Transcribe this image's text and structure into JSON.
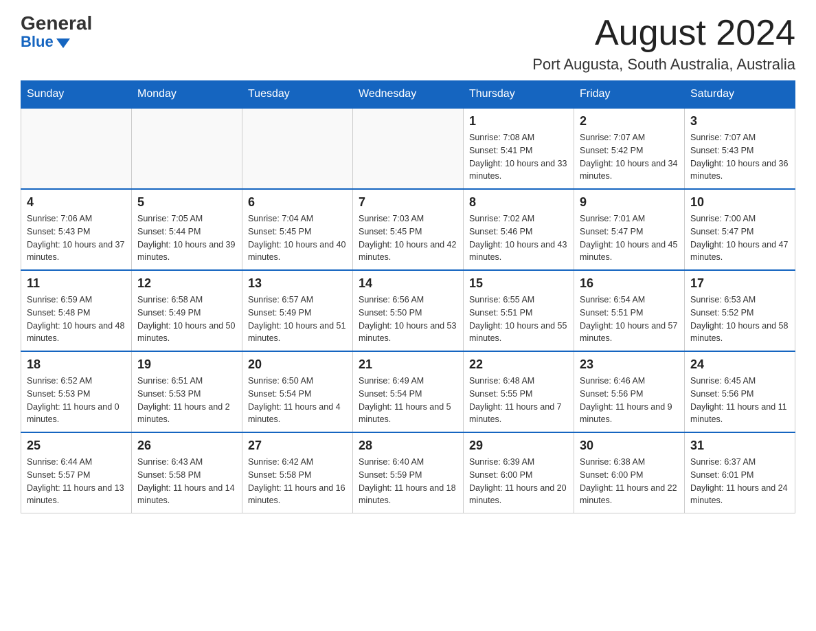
{
  "header": {
    "logo_general": "General",
    "logo_blue": "Blue",
    "month_title": "August 2024",
    "location": "Port Augusta, South Australia, Australia"
  },
  "calendar": {
    "days_of_week": [
      "Sunday",
      "Monday",
      "Tuesday",
      "Wednesday",
      "Thursday",
      "Friday",
      "Saturday"
    ],
    "weeks": [
      [
        {
          "day": "",
          "info": ""
        },
        {
          "day": "",
          "info": ""
        },
        {
          "day": "",
          "info": ""
        },
        {
          "day": "",
          "info": ""
        },
        {
          "day": "1",
          "info": "Sunrise: 7:08 AM\nSunset: 5:41 PM\nDaylight: 10 hours and 33 minutes."
        },
        {
          "day": "2",
          "info": "Sunrise: 7:07 AM\nSunset: 5:42 PM\nDaylight: 10 hours and 34 minutes."
        },
        {
          "day": "3",
          "info": "Sunrise: 7:07 AM\nSunset: 5:43 PM\nDaylight: 10 hours and 36 minutes."
        }
      ],
      [
        {
          "day": "4",
          "info": "Sunrise: 7:06 AM\nSunset: 5:43 PM\nDaylight: 10 hours and 37 minutes."
        },
        {
          "day": "5",
          "info": "Sunrise: 7:05 AM\nSunset: 5:44 PM\nDaylight: 10 hours and 39 minutes."
        },
        {
          "day": "6",
          "info": "Sunrise: 7:04 AM\nSunset: 5:45 PM\nDaylight: 10 hours and 40 minutes."
        },
        {
          "day": "7",
          "info": "Sunrise: 7:03 AM\nSunset: 5:45 PM\nDaylight: 10 hours and 42 minutes."
        },
        {
          "day": "8",
          "info": "Sunrise: 7:02 AM\nSunset: 5:46 PM\nDaylight: 10 hours and 43 minutes."
        },
        {
          "day": "9",
          "info": "Sunrise: 7:01 AM\nSunset: 5:47 PM\nDaylight: 10 hours and 45 minutes."
        },
        {
          "day": "10",
          "info": "Sunrise: 7:00 AM\nSunset: 5:47 PM\nDaylight: 10 hours and 47 minutes."
        }
      ],
      [
        {
          "day": "11",
          "info": "Sunrise: 6:59 AM\nSunset: 5:48 PM\nDaylight: 10 hours and 48 minutes."
        },
        {
          "day": "12",
          "info": "Sunrise: 6:58 AM\nSunset: 5:49 PM\nDaylight: 10 hours and 50 minutes."
        },
        {
          "day": "13",
          "info": "Sunrise: 6:57 AM\nSunset: 5:49 PM\nDaylight: 10 hours and 51 minutes."
        },
        {
          "day": "14",
          "info": "Sunrise: 6:56 AM\nSunset: 5:50 PM\nDaylight: 10 hours and 53 minutes."
        },
        {
          "day": "15",
          "info": "Sunrise: 6:55 AM\nSunset: 5:51 PM\nDaylight: 10 hours and 55 minutes."
        },
        {
          "day": "16",
          "info": "Sunrise: 6:54 AM\nSunset: 5:51 PM\nDaylight: 10 hours and 57 minutes."
        },
        {
          "day": "17",
          "info": "Sunrise: 6:53 AM\nSunset: 5:52 PM\nDaylight: 10 hours and 58 minutes."
        }
      ],
      [
        {
          "day": "18",
          "info": "Sunrise: 6:52 AM\nSunset: 5:53 PM\nDaylight: 11 hours and 0 minutes."
        },
        {
          "day": "19",
          "info": "Sunrise: 6:51 AM\nSunset: 5:53 PM\nDaylight: 11 hours and 2 minutes."
        },
        {
          "day": "20",
          "info": "Sunrise: 6:50 AM\nSunset: 5:54 PM\nDaylight: 11 hours and 4 minutes."
        },
        {
          "day": "21",
          "info": "Sunrise: 6:49 AM\nSunset: 5:54 PM\nDaylight: 11 hours and 5 minutes."
        },
        {
          "day": "22",
          "info": "Sunrise: 6:48 AM\nSunset: 5:55 PM\nDaylight: 11 hours and 7 minutes."
        },
        {
          "day": "23",
          "info": "Sunrise: 6:46 AM\nSunset: 5:56 PM\nDaylight: 11 hours and 9 minutes."
        },
        {
          "day": "24",
          "info": "Sunrise: 6:45 AM\nSunset: 5:56 PM\nDaylight: 11 hours and 11 minutes."
        }
      ],
      [
        {
          "day": "25",
          "info": "Sunrise: 6:44 AM\nSunset: 5:57 PM\nDaylight: 11 hours and 13 minutes."
        },
        {
          "day": "26",
          "info": "Sunrise: 6:43 AM\nSunset: 5:58 PM\nDaylight: 11 hours and 14 minutes."
        },
        {
          "day": "27",
          "info": "Sunrise: 6:42 AM\nSunset: 5:58 PM\nDaylight: 11 hours and 16 minutes."
        },
        {
          "day": "28",
          "info": "Sunrise: 6:40 AM\nSunset: 5:59 PM\nDaylight: 11 hours and 18 minutes."
        },
        {
          "day": "29",
          "info": "Sunrise: 6:39 AM\nSunset: 6:00 PM\nDaylight: 11 hours and 20 minutes."
        },
        {
          "day": "30",
          "info": "Sunrise: 6:38 AM\nSunset: 6:00 PM\nDaylight: 11 hours and 22 minutes."
        },
        {
          "day": "31",
          "info": "Sunrise: 6:37 AM\nSunset: 6:01 PM\nDaylight: 11 hours and 24 minutes."
        }
      ]
    ]
  }
}
